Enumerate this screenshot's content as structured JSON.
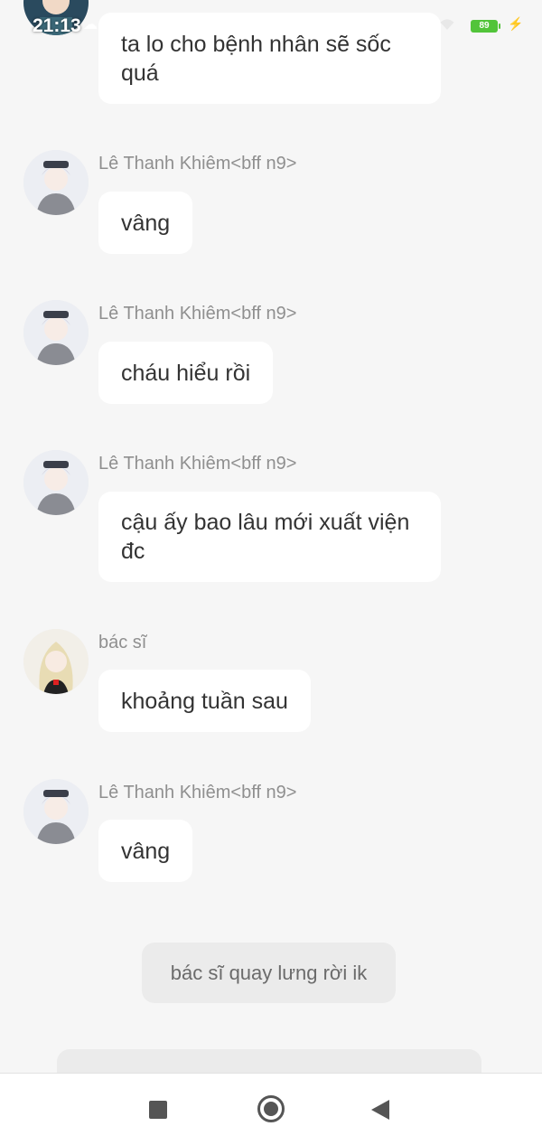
{
  "status_bar": {
    "time": "21:13",
    "battery": "89"
  },
  "messages": [
    {
      "sender": "",
      "text": "ta lo cho bệnh nhân sẽ sốc quá",
      "avatar": "avatar-dark-hair"
    },
    {
      "sender": "Lê Thanh Khiêm<bff n9>",
      "text": "vâng",
      "avatar": "avatar-white-hair"
    },
    {
      "sender": "Lê Thanh Khiêm<bff n9>",
      "text": "cháu hiểu rồi",
      "avatar": "avatar-white-hair"
    },
    {
      "sender": "Lê Thanh Khiêm<bff n9>",
      "text": "cậu ấy bao lâu mới xuất viện đc",
      "avatar": "avatar-white-hair"
    },
    {
      "sender": "bác sĩ",
      "text": "khoảng tuần sau",
      "avatar": "avatar-blonde"
    },
    {
      "sender": "Lê Thanh Khiêm<bff n9>",
      "text": "vâng",
      "avatar": "avatar-white-hair"
    }
  ],
  "narration": "bác sĩ quay lưng rời ik",
  "nav_bar": {
    "icons": [
      "recent-apps-square-icon",
      "home-circle-icon",
      "back-triangle-icon"
    ]
  }
}
